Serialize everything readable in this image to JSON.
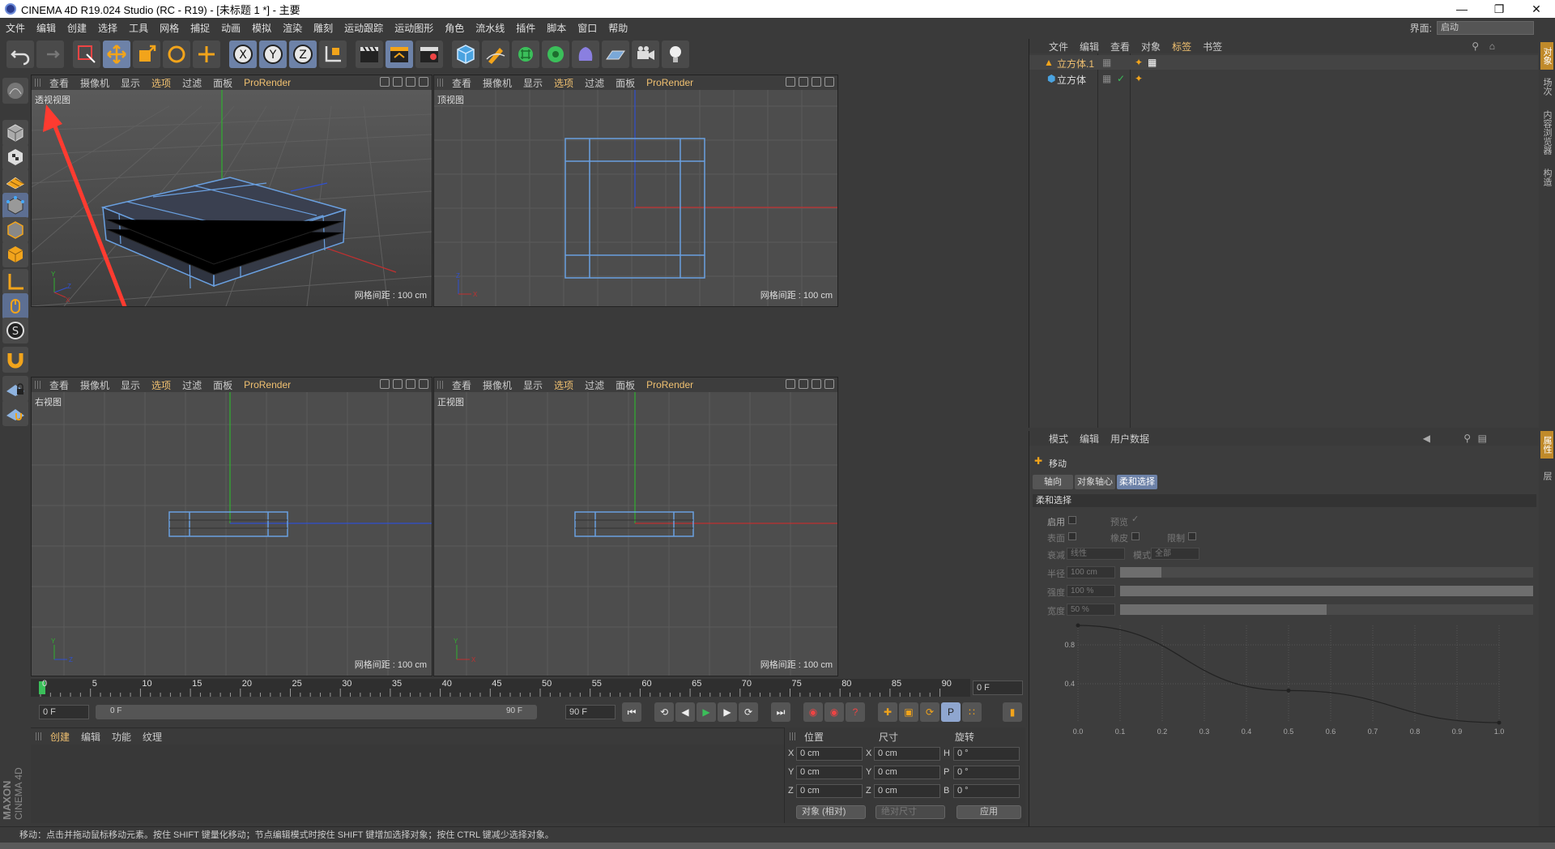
{
  "window": {
    "title": "CINEMA 4D R19.024 Studio (RC - R19) - [未标题 1 *] - 主要"
  },
  "menu": [
    "文件",
    "编辑",
    "创建",
    "选择",
    "工具",
    "网格",
    "捕捉",
    "动画",
    "模拟",
    "渲染",
    "雕刻",
    "运动跟踪",
    "运动图形",
    "角色",
    "流水线",
    "插件",
    "脚本",
    "窗口",
    "帮助"
  ],
  "layout": {
    "label": "界面:",
    "value": "启动"
  },
  "viewport_menu": [
    "查看",
    "摄像机",
    "显示",
    "选项",
    "过滤",
    "面板"
  ],
  "viewport_menu_renderer": "ProRender",
  "viewports": {
    "perspective": {
      "name": "透视视图",
      "grid": "网格间距 : 100 cm"
    },
    "top": {
      "name": "顶视图",
      "grid": "网格间距 : 100 cm"
    },
    "right": {
      "name": "右视图",
      "grid": "网格间距 : 100 cm"
    },
    "front": {
      "name": "正视图",
      "grid": "网格间距 : 100 cm"
    }
  },
  "axis_labels": {
    "x": "X",
    "y": "Y",
    "z": "Z"
  },
  "timeline": {
    "ticks": [
      "0",
      "5",
      "10",
      "15",
      "20",
      "25",
      "30",
      "35",
      "40",
      "45",
      "50",
      "55",
      "60",
      "65",
      "70",
      "75",
      "80",
      "85",
      "90"
    ],
    "current": "0 F"
  },
  "transport": {
    "start": "0 F",
    "range_start": "0 F",
    "range_end": "90 F",
    "end": "90 F"
  },
  "material_menu": [
    "创建",
    "编辑",
    "功能",
    "纹理"
  ],
  "brand": {
    "name": "MAXON",
    "product": "CINEMA 4D"
  },
  "coords": {
    "headers": {
      "position": "位置",
      "size": "尺寸",
      "rotation": "旋转"
    },
    "rows": [
      {
        "axis": "X",
        "pos": "0 cm",
        "size_axis": "X",
        "size": "0 cm",
        "rot_axis": "H",
        "rot": "0 °"
      },
      {
        "axis": "Y",
        "pos": "0 cm",
        "size_axis": "Y",
        "size": "0 cm",
        "rot_axis": "P",
        "rot": "0 °"
      },
      {
        "axis": "Z",
        "pos": "0 cm",
        "size_axis": "Z",
        "size": "0 cm",
        "rot_axis": "B",
        "rot": "0 °"
      }
    ],
    "mode": "对象 (相对)",
    "size_mode": "绝对尺寸",
    "apply": "应用"
  },
  "object_manager": {
    "menu": [
      "文件",
      "编辑",
      "查看",
      "对象",
      "标签",
      "书签"
    ],
    "active_menu": "标签",
    "objects": [
      {
        "name": "立方体.1",
        "selected": true
      },
      {
        "name": "立方体",
        "selected": false
      }
    ]
  },
  "attribute_manager": {
    "menu": [
      "模式",
      "编辑",
      "用户数据"
    ],
    "tool": "移动",
    "tabs": [
      "轴向",
      "对象轴心",
      "柔和选择"
    ],
    "active_tab": "柔和选择",
    "section": "柔和选择",
    "fields": {
      "enable": "启用",
      "preview": "预览",
      "surface": "表面",
      "rubber": "橡皮",
      "limit": "限制",
      "falloff": "衰减",
      "falloff_value": "线性",
      "mode": "模式",
      "mode_value": "全部",
      "radius": "半径",
      "radius_value": "100 cm",
      "strength": "强度",
      "strength_value": "100 %",
      "width": "宽度",
      "width_value": "50 %"
    },
    "radius_fraction": 0.1,
    "strength_fraction": 1.0,
    "width_fraction": 0.5,
    "curve": {
      "x_ticks": [
        "0.0",
        "0.1",
        "0.2",
        "0.3",
        "0.4",
        "0.5",
        "0.6",
        "0.7",
        "0.8",
        "0.9",
        "1.0"
      ],
      "y_ticks": [
        "0.8",
        "0.4"
      ],
      "points": [
        [
          0.0,
          1.0
        ],
        [
          0.5,
          0.33
        ],
        [
          1.0,
          0.0
        ]
      ]
    }
  },
  "side_tabs": [
    "对象",
    "场次",
    "内容浏览器",
    "构造",
    "属性",
    "层"
  ],
  "status": "移动：点击并拖动鼠标移动元素。按住 SHIFT 键量化移动；节点编辑模式时按住 SHIFT 键增加选择对象；按住 CTRL 键减少选择对象。",
  "colors": {
    "accent": "#f0c070",
    "selection": "#6d82a8",
    "wire": "#6aa0e0",
    "x_axis": "#c03030",
    "y_axis": "#30b030",
    "z_axis": "#3050d0",
    "arrow": "#ff3b30"
  }
}
